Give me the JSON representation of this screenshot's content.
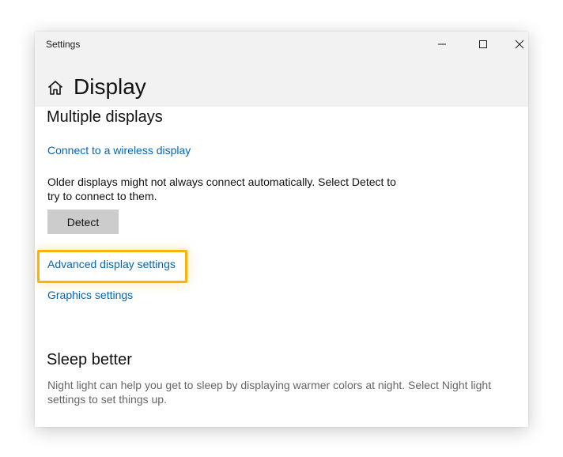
{
  "window": {
    "app_title": "Settings",
    "controls": {
      "minimize_icon": "minimize-icon",
      "maximize_icon": "maximize-icon",
      "close_icon": "close-icon"
    }
  },
  "header": {
    "home_icon": "home-icon",
    "title": "Display"
  },
  "multiple_displays": {
    "heading": "Multiple displays",
    "wireless_link": "Connect to a wireless display",
    "description": "Older displays might not always connect automatically. Select Detect to try to connect to them.",
    "detect_button": "Detect",
    "advanced_link": "Advanced display settings",
    "graphics_link": "Graphics settings"
  },
  "sleep_better": {
    "heading": "Sleep better",
    "description": "Night light can help you get to sleep by displaying warmer colors at night. Select Night light settings to set things up."
  },
  "colors": {
    "link": "#0067b8",
    "highlight": "#f8b40a",
    "button": "#cccccc",
    "header_bg": "#f2f2f2"
  }
}
